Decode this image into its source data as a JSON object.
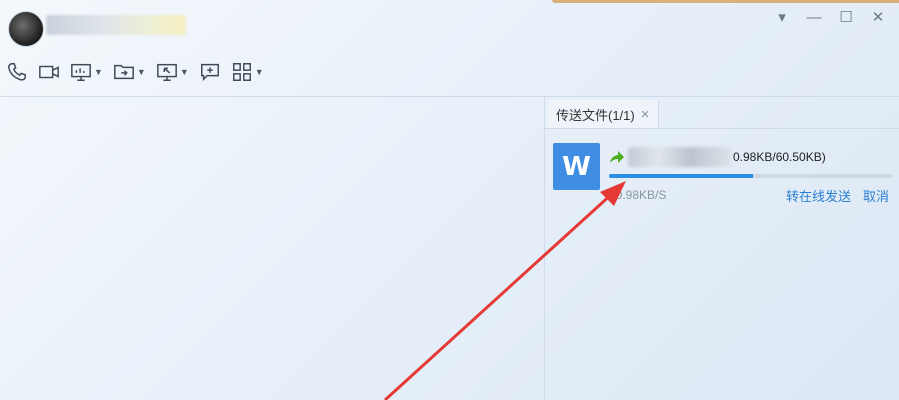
{
  "window": {
    "controls": [
      "▾",
      "—",
      "☐",
      "✕"
    ]
  },
  "toolbar": {
    "tools": [
      {
        "icon": "phone-icon",
        "dropdown": false
      },
      {
        "icon": "video-call-icon",
        "dropdown": false
      },
      {
        "icon": "remote-desktop-icon",
        "dropdown": true
      },
      {
        "icon": "transfer-file-icon",
        "dropdown": true
      },
      {
        "icon": "screenshot-icon",
        "dropdown": true
      },
      {
        "icon": "add-comment-icon",
        "dropdown": false
      },
      {
        "icon": "apps-grid-icon",
        "dropdown": true
      }
    ]
  },
  "panel": {
    "tab_label": "传送文件(1/1)",
    "tab_close": "×",
    "file": {
      "icon_letter": "W",
      "size": "0.98KB/60.50KB)",
      "speed": "30.98KB/S",
      "progress_percent": 51,
      "actions": {
        "offline": "转在线发送",
        "cancel": "取消"
      }
    }
  },
  "colors": {
    "accent": "#2a8fe0",
    "annotation": "#e53935",
    "word_blue": "#3f8ee4"
  }
}
